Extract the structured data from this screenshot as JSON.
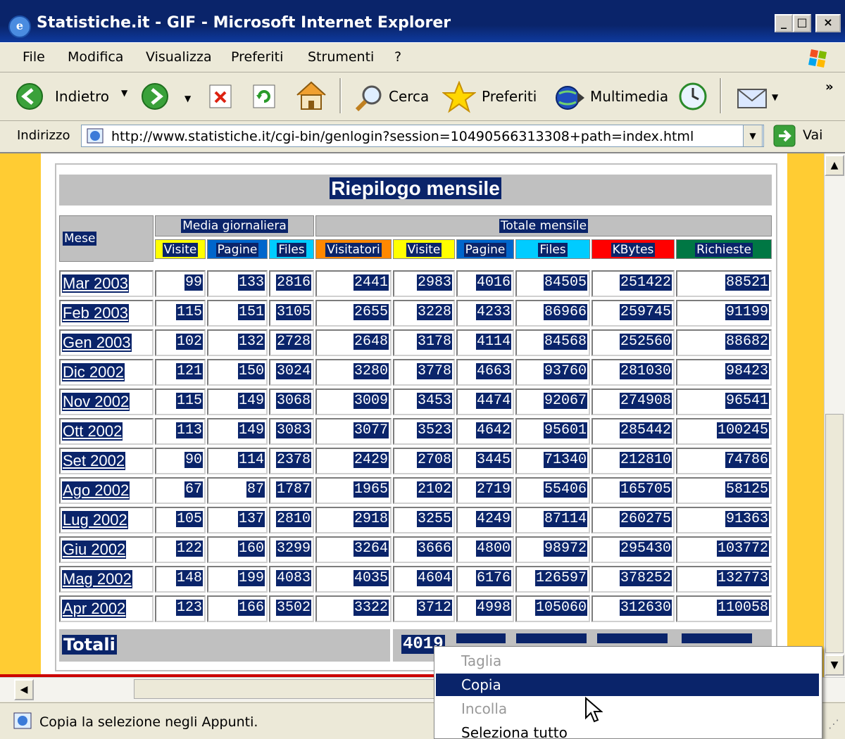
{
  "window": {
    "title": "Statistiche.it - GIF - Microsoft Internet Explorer",
    "caption_buttons": [
      "_",
      "□",
      "×"
    ]
  },
  "menubar": {
    "items": [
      "File",
      "Modifica",
      "Visualizza",
      "Preferiti",
      "Strumenti",
      "?"
    ]
  },
  "toolbar": {
    "back_label": "Indietro",
    "search_label": "Cerca",
    "favorites_label": "Preferiti",
    "media_label": "Multimedia"
  },
  "address": {
    "label": "Indirizzo",
    "url": "http://www.statistiche.it/cgi-bin/genlogin?session=10490566313308+path=index.html",
    "go_label": "Vai"
  },
  "table": {
    "title": "Riepilogo mensile",
    "group_daily": "Media giornaliera",
    "group_monthly": "Totale mensile",
    "col_month": "Mese",
    "columns": [
      "Visite",
      "Pagine",
      "Files",
      "Visitatori",
      "Visite",
      "Pagine",
      "Files",
      "KBytes",
      "Richieste"
    ],
    "column_colors": [
      "#ffff00",
      "#0066cc",
      "#00ccff",
      "#ff8800",
      "#ffff00",
      "#0066cc",
      "#00ccff",
      "#ff0000",
      "#007744"
    ],
    "rows": [
      {
        "month": "Mar 2003",
        "values": [
          "99",
          "133",
          "2816",
          "2441",
          "2983",
          "4016",
          "84505",
          "251422",
          "88521"
        ]
      },
      {
        "month": "Feb 2003",
        "values": [
          "115",
          "151",
          "3105",
          "2655",
          "3228",
          "4233",
          "86966",
          "259745",
          "91199"
        ]
      },
      {
        "month": "Gen 2003",
        "values": [
          "102",
          "132",
          "2728",
          "2648",
          "3178",
          "4114",
          "84568",
          "252560",
          "88682"
        ]
      },
      {
        "month": "Dic 2002",
        "values": [
          "121",
          "150",
          "3024",
          "3280",
          "3778",
          "4663",
          "93760",
          "281030",
          "98423"
        ]
      },
      {
        "month": "Nov 2002",
        "values": [
          "115",
          "149",
          "3068",
          "3009",
          "3453",
          "4474",
          "92067",
          "274908",
          "96541"
        ]
      },
      {
        "month": "Ott 2002",
        "values": [
          "113",
          "149",
          "3083",
          "3077",
          "3523",
          "4642",
          "95601",
          "285442",
          "100245"
        ]
      },
      {
        "month": "Set 2002",
        "values": [
          "90",
          "114",
          "2378",
          "2429",
          "2708",
          "3445",
          "71340",
          "212810",
          "74786"
        ]
      },
      {
        "month": "Ago 2002",
        "values": [
          "67",
          "87",
          "1787",
          "1965",
          "2102",
          "2719",
          "55406",
          "165705",
          "58125"
        ]
      },
      {
        "month": "Lug 2002",
        "values": [
          "105",
          "137",
          "2810",
          "2918",
          "3255",
          "4249",
          "87114",
          "260275",
          "91363"
        ]
      },
      {
        "month": "Giu 2002",
        "values": [
          "122",
          "160",
          "3299",
          "3264",
          "3666",
          "4800",
          "98972",
          "295430",
          "103772"
        ]
      },
      {
        "month": "Mag 2002",
        "values": [
          "148",
          "199",
          "4083",
          "4035",
          "4604",
          "6176",
          "126597",
          "378252",
          "132773"
        ]
      },
      {
        "month": "Apr 2002",
        "values": [
          "123",
          "166",
          "3502",
          "3322",
          "3712",
          "4998",
          "105060",
          "312630",
          "110058"
        ]
      }
    ],
    "totals_label": "Totali",
    "totals_visible": [
      "4019"
    ]
  },
  "context_menu": {
    "items": [
      {
        "label": "Taglia",
        "state": "disabled"
      },
      {
        "label": "Copia",
        "state": "highlighted"
      },
      {
        "label": "Incolla",
        "state": "disabled"
      },
      {
        "label": "Seleziona tutto",
        "state": "enabled"
      }
    ]
  },
  "statusbar": {
    "text": "Copia la selezione negli Appunti."
  }
}
